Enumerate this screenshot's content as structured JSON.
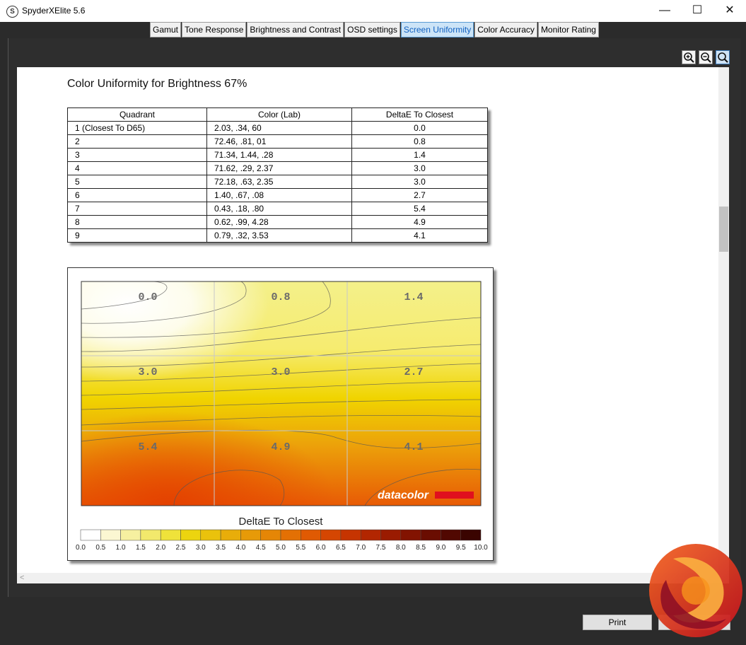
{
  "window": {
    "app_icon_letter": "S",
    "title": "SpyderXElite 5.6",
    "minimize_glyph": "—",
    "maximize_glyph": "☐",
    "close_glyph": "✕"
  },
  "tabs": [
    "Gamut",
    "Tone Response",
    "Brightness and Contrast",
    "OSD settings",
    "Screen Uniformity",
    "Color Accuracy",
    "Monitor Rating"
  ],
  "active_tab": "Screen Uniformity",
  "zoom_tools": [
    "zoom-in-icon",
    "zoom-out-icon",
    "zoom-fit-icon"
  ],
  "report": {
    "title": "Color Uniformity for Brightness 67%",
    "table": {
      "headers": [
        "Quadrant",
        "Color (Lab)",
        "DeltaE To Closest"
      ],
      "rows": [
        [
          "1 (Closest To D65)",
          "2.03,     .34,     60",
          "0.0"
        ],
        [
          "2",
          "72.46,     .81,     01",
          "0.8"
        ],
        [
          "3",
          "71.34,   1.44,     .28",
          "1.4"
        ],
        [
          "4",
          "71.62,     .29,   2.37",
          "3.0"
        ],
        [
          "5",
          "72.18,     .63,   2.35",
          "3.0"
        ],
        [
          "6",
          "1.40,     .67,     .08",
          "2.7"
        ],
        [
          "7",
          "0.43,     .18,     .80",
          "5.4"
        ],
        [
          "8",
          "0.62,     .99,   4.28",
          "4.9"
        ],
        [
          "9",
          "0.79,     .32,   3.53",
          "4.1"
        ]
      ]
    }
  },
  "uniformity_map": {
    "quadrant_values": [
      "0.0",
      "0.8",
      "1.4",
      "3.0",
      "3.0",
      "2.7",
      "5.4",
      "4.9",
      "4.1"
    ],
    "watermark": "datacolor",
    "legend_title": "DeltaE To Closest",
    "legend_ticks": [
      "0.0",
      "0.5",
      "1.0",
      "1.5",
      "2.0",
      "2.5",
      "3.0",
      "3.5",
      "4.0",
      "4.5",
      "5.0",
      "5.5",
      "6.0",
      "6.5",
      "7.0",
      "7.5",
      "8.0",
      "8.5",
      "9.0",
      "9.5",
      "10.0"
    ],
    "legend_colors": [
      "#ffffff",
      "#fbf7d2",
      "#f6f0a0",
      "#f2e96c",
      "#efe23a",
      "#ecd40f",
      "#eac20c",
      "#e8ad0a",
      "#e79a08",
      "#e58606",
      "#e37004",
      "#e05a03",
      "#d54602",
      "#c63401",
      "#b22601",
      "#9a1b01",
      "#821301",
      "#6a0d01",
      "#510801",
      "#3a0400"
    ],
    "colors": {
      "cold": "#ffffff",
      "mid": "#f0d800",
      "hot": "#e84800"
    }
  },
  "buttons": {
    "print": "Print"
  }
}
